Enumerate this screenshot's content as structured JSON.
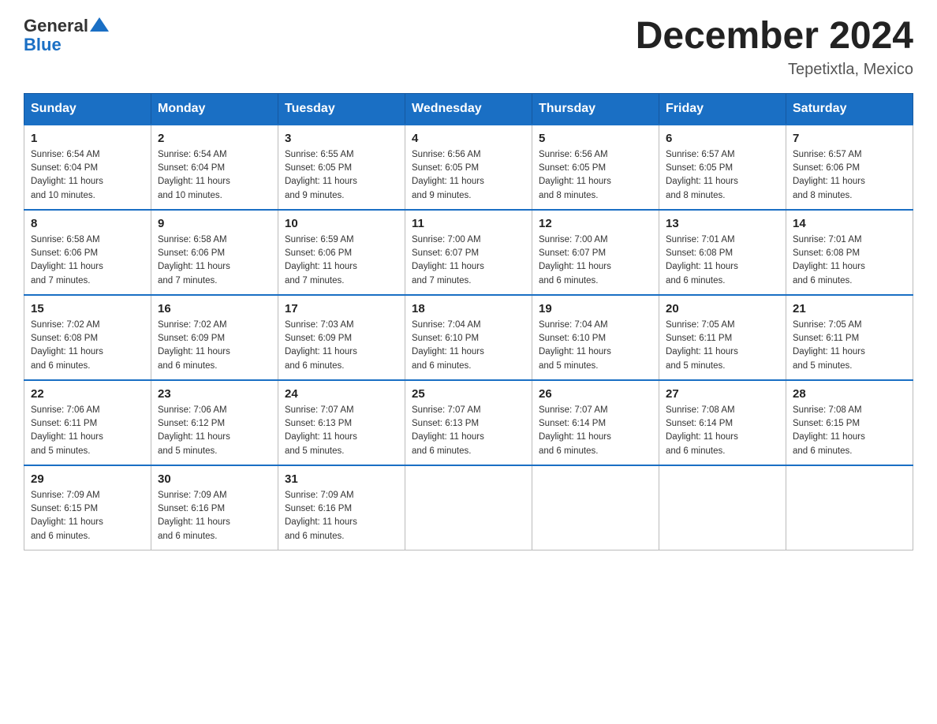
{
  "header": {
    "logo_general": "General",
    "logo_blue": "Blue",
    "month_title": "December 2024",
    "location": "Tepetixtla, Mexico"
  },
  "days_of_week": [
    "Sunday",
    "Monday",
    "Tuesday",
    "Wednesday",
    "Thursday",
    "Friday",
    "Saturday"
  ],
  "weeks": [
    [
      {
        "num": "1",
        "sunrise": "6:54 AM",
        "sunset": "6:04 PM",
        "daylight": "11 hours and 10 minutes."
      },
      {
        "num": "2",
        "sunrise": "6:54 AM",
        "sunset": "6:04 PM",
        "daylight": "11 hours and 10 minutes."
      },
      {
        "num": "3",
        "sunrise": "6:55 AM",
        "sunset": "6:05 PM",
        "daylight": "11 hours and 9 minutes."
      },
      {
        "num": "4",
        "sunrise": "6:56 AM",
        "sunset": "6:05 PM",
        "daylight": "11 hours and 9 minutes."
      },
      {
        "num": "5",
        "sunrise": "6:56 AM",
        "sunset": "6:05 PM",
        "daylight": "11 hours and 8 minutes."
      },
      {
        "num": "6",
        "sunrise": "6:57 AM",
        "sunset": "6:05 PM",
        "daylight": "11 hours and 8 minutes."
      },
      {
        "num": "7",
        "sunrise": "6:57 AM",
        "sunset": "6:06 PM",
        "daylight": "11 hours and 8 minutes."
      }
    ],
    [
      {
        "num": "8",
        "sunrise": "6:58 AM",
        "sunset": "6:06 PM",
        "daylight": "11 hours and 7 minutes."
      },
      {
        "num": "9",
        "sunrise": "6:58 AM",
        "sunset": "6:06 PM",
        "daylight": "11 hours and 7 minutes."
      },
      {
        "num": "10",
        "sunrise": "6:59 AM",
        "sunset": "6:06 PM",
        "daylight": "11 hours and 7 minutes."
      },
      {
        "num": "11",
        "sunrise": "7:00 AM",
        "sunset": "6:07 PM",
        "daylight": "11 hours and 7 minutes."
      },
      {
        "num": "12",
        "sunrise": "7:00 AM",
        "sunset": "6:07 PM",
        "daylight": "11 hours and 6 minutes."
      },
      {
        "num": "13",
        "sunrise": "7:01 AM",
        "sunset": "6:08 PM",
        "daylight": "11 hours and 6 minutes."
      },
      {
        "num": "14",
        "sunrise": "7:01 AM",
        "sunset": "6:08 PM",
        "daylight": "11 hours and 6 minutes."
      }
    ],
    [
      {
        "num": "15",
        "sunrise": "7:02 AM",
        "sunset": "6:08 PM",
        "daylight": "11 hours and 6 minutes."
      },
      {
        "num": "16",
        "sunrise": "7:02 AM",
        "sunset": "6:09 PM",
        "daylight": "11 hours and 6 minutes."
      },
      {
        "num": "17",
        "sunrise": "7:03 AM",
        "sunset": "6:09 PM",
        "daylight": "11 hours and 6 minutes."
      },
      {
        "num": "18",
        "sunrise": "7:04 AM",
        "sunset": "6:10 PM",
        "daylight": "11 hours and 6 minutes."
      },
      {
        "num": "19",
        "sunrise": "7:04 AM",
        "sunset": "6:10 PM",
        "daylight": "11 hours and 5 minutes."
      },
      {
        "num": "20",
        "sunrise": "7:05 AM",
        "sunset": "6:11 PM",
        "daylight": "11 hours and 5 minutes."
      },
      {
        "num": "21",
        "sunrise": "7:05 AM",
        "sunset": "6:11 PM",
        "daylight": "11 hours and 5 minutes."
      }
    ],
    [
      {
        "num": "22",
        "sunrise": "7:06 AM",
        "sunset": "6:11 PM",
        "daylight": "11 hours and 5 minutes."
      },
      {
        "num": "23",
        "sunrise": "7:06 AM",
        "sunset": "6:12 PM",
        "daylight": "11 hours and 5 minutes."
      },
      {
        "num": "24",
        "sunrise": "7:07 AM",
        "sunset": "6:13 PM",
        "daylight": "11 hours and 5 minutes."
      },
      {
        "num": "25",
        "sunrise": "7:07 AM",
        "sunset": "6:13 PM",
        "daylight": "11 hours and 6 minutes."
      },
      {
        "num": "26",
        "sunrise": "7:07 AM",
        "sunset": "6:14 PM",
        "daylight": "11 hours and 6 minutes."
      },
      {
        "num": "27",
        "sunrise": "7:08 AM",
        "sunset": "6:14 PM",
        "daylight": "11 hours and 6 minutes."
      },
      {
        "num": "28",
        "sunrise": "7:08 AM",
        "sunset": "6:15 PM",
        "daylight": "11 hours and 6 minutes."
      }
    ],
    [
      {
        "num": "29",
        "sunrise": "7:09 AM",
        "sunset": "6:15 PM",
        "daylight": "11 hours and 6 minutes."
      },
      {
        "num": "30",
        "sunrise": "7:09 AM",
        "sunset": "6:16 PM",
        "daylight": "11 hours and 6 minutes."
      },
      {
        "num": "31",
        "sunrise": "7:09 AM",
        "sunset": "6:16 PM",
        "daylight": "11 hours and 6 minutes."
      },
      null,
      null,
      null,
      null
    ]
  ],
  "labels": {
    "sunrise": "Sunrise:",
    "sunset": "Sunset:",
    "daylight": "Daylight:"
  }
}
